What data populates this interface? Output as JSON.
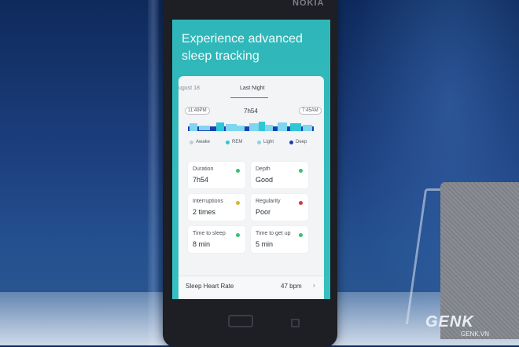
{
  "phone": {
    "brand": "NOKIA"
  },
  "screen": {
    "headline": "Experience advanced sleep tracking",
    "tabs": {
      "previous": "ugust 18",
      "active": "Last Night"
    },
    "sleep_chart": {
      "start_time": "11:49PM",
      "end_time": "7:45AM",
      "duration": "7h54",
      "legend": [
        {
          "label": "Awake",
          "color": "#c9cdd2"
        },
        {
          "label": "REM",
          "color": "#2fc6d6"
        },
        {
          "label": "Light",
          "color": "#7fd6ee"
        },
        {
          "label": "Deep",
          "color": "#1a3fb5"
        }
      ]
    },
    "metrics": [
      {
        "label": "Duration",
        "value": "7h54",
        "status_color": "#3bbf74"
      },
      {
        "label": "Depth",
        "value": "Good",
        "status_color": "#3bbf74"
      },
      {
        "label": "Interruptions",
        "value": "2 times",
        "status_color": "#d8b72a"
      },
      {
        "label": "Regularity",
        "value": "Poor",
        "status_color": "#d23a3a"
      },
      {
        "label": "Time to sleep",
        "value": "8 min",
        "status_color": "#3bbf74"
      },
      {
        "label": "Time to get up",
        "value": "5 min",
        "status_color": "#3bbf74"
      }
    ],
    "heart_rate": {
      "label": "Sleep Heart Rate",
      "value": "47 bpm"
    }
  },
  "watermark": {
    "logo": "GENK",
    "site": "GENK.VN"
  }
}
